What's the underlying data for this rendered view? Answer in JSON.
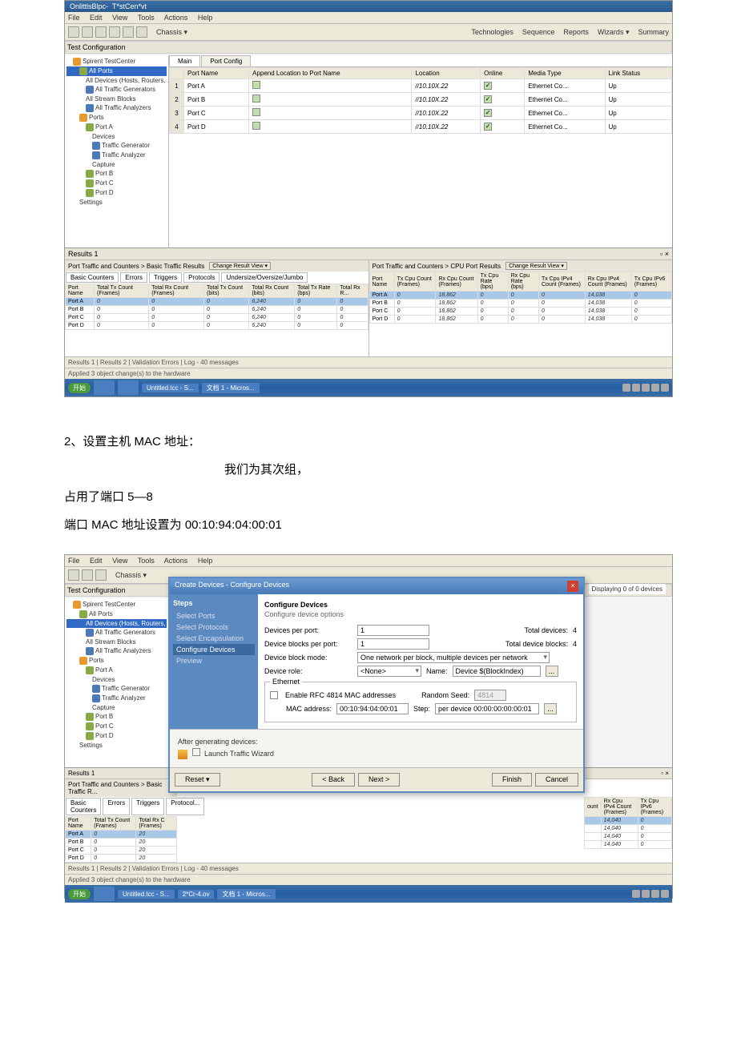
{
  "shot1": {
    "title_left": "OnlittlsBlpc-",
    "title_app": "T*stCen*vt",
    "menu": [
      "File",
      "Edit",
      "View",
      "Tools",
      "Actions",
      "Help"
    ],
    "toolbar_tabs": [
      "Technologies",
      "Sequence",
      "Reports",
      "Wizards",
      "Summary"
    ],
    "tree_header": "Test Configuration",
    "tree": {
      "root": "Spirent TestCenter",
      "all_ports": "All Ports",
      "all_devices": "All Devices (Hosts, Routers, ...)",
      "traffic_gen": "All Traffic Generators",
      "stream_blocks": "All Stream Blocks",
      "traffic_analyzers": "All Traffic Analyzers",
      "ports": "Ports",
      "port_a": "Port A",
      "devices": "Devices",
      "t_gen": "Traffic Generator",
      "t_ana": "Traffic Analyzer",
      "capture": "Capture",
      "port_b": "Port B",
      "port_c": "Port C",
      "port_d": "Port D",
      "settings": "Settings"
    },
    "port_tabs": {
      "main": "Main",
      "port_config": "Port Config"
    },
    "port_grid": {
      "headers": [
        "Port Name",
        "Append Location to Port Name",
        "Location",
        "Online",
        "Media Type",
        "Link Status"
      ],
      "rows": [
        {
          "idx": "1",
          "name": "Port A",
          "loc": "//10.10X.22",
          "media": "Ethernet Co...",
          "link": "Up"
        },
        {
          "idx": "2",
          "name": "Port B",
          "loc": "//10.10X.22",
          "media": "Ethernet Co...",
          "link": "Up"
        },
        {
          "idx": "3",
          "name": "Port C",
          "loc": "//10.10X.22",
          "media": "Ethernet Co...",
          "link": "Up"
        },
        {
          "idx": "4",
          "name": "Port D",
          "loc": "//10.10X.22",
          "media": "Ethernet Co...",
          "link": "Up"
        }
      ]
    },
    "results_label": "Results 1",
    "results_left_title": "Port Traffic and Counters > Basic Traffic Results",
    "results_right_title": "Port Traffic and Counters > CPU Port Results",
    "change_view": "Change Result View",
    "subtabs": [
      "Basic Counters",
      "Errors",
      "Triggers",
      "Protocols",
      "Undersize/Oversize/Jumbo"
    ],
    "left_headers": [
      "Port Name",
      "Total Tx Count (Frames)",
      "Total Rx Count (Frames)",
      "Total Tx Count (bits)",
      "Total Rx Count (bits)",
      "Total Tx Rate (bps)",
      "Total Rx R..."
    ],
    "right_headers": [
      "Port Name",
      "Tx Cpu Count (Frames)",
      "Rx Cpu Count (Frames)",
      "Tx Cpu Rate (bps)",
      "Rx Cpu Rate (bps)",
      "Tx Cpu IPv4 Count (Frames)",
      "Rx Cpu IPv4 Count (Frames)",
      "Tx Cpu IPv6 (Frames)"
    ],
    "left_rows": [
      {
        "name": "Port A",
        "c1": "0",
        "c2": "0",
        "c3": "0",
        "c4": "6,240",
        "c5": "0",
        "c6": "0"
      },
      {
        "name": "Port B",
        "c1": "0",
        "c2": "0",
        "c3": "0",
        "c4": "6,240",
        "c5": "0",
        "c6": "0"
      },
      {
        "name": "Port C",
        "c1": "0",
        "c2": "0",
        "c3": "0",
        "c4": "6,240",
        "c5": "0",
        "c6": "0"
      },
      {
        "name": "Port D",
        "c1": "0",
        "c2": "0",
        "c3": "0",
        "c4": "6,240",
        "c5": "0",
        "c6": "0"
      }
    ],
    "right_rows": [
      {
        "name": "Port A",
        "c1": "0",
        "c2": "18,862",
        "c3": "0",
        "c4": "0",
        "c5": "0",
        "c6": "14,038",
        "c7": "0"
      },
      {
        "name": "Port B",
        "c1": "0",
        "c2": "18,862",
        "c3": "0",
        "c4": "0",
        "c5": "0",
        "c6": "14,038",
        "c7": "0"
      },
      {
        "name": "Port C",
        "c1": "0",
        "c2": "18,862",
        "c3": "0",
        "c4": "0",
        "c5": "0",
        "c6": "14,038",
        "c7": "0"
      },
      {
        "name": "Port D",
        "c1": "0",
        "c2": "18,862",
        "c3": "0",
        "c4": "0",
        "c5": "0",
        "c6": "14,038",
        "c7": "0"
      }
    ],
    "bottom_tabs": "Results 1 | Results 2 | Validation Errors | Log - 40 messages",
    "status": "Applied 3 object change(s) to the hardware",
    "taskbar": {
      "items": [
        "",
        "",
        "",
        "Untitled.tcc - S..."
      ],
      "item5": "文档 1 - Micros..."
    }
  },
  "body": {
    "line1": "2、设置主机 MAC 地址：",
    "line2": "我们为其次组，",
    "line3": "占用了端口 5—8",
    "line4": "端口 MAC 地址设置为 00:10:94:04:00:01"
  },
  "shot2": {
    "dialog_title": "Create Devices - Configure Devices",
    "steps_hdr": "Steps",
    "steps": [
      "Select Ports",
      "Select Protocols",
      "Select Encapsulation",
      "Configure Devices",
      "Preview"
    ],
    "cfg_title": "Configure Devices",
    "cfg_sub": "Configure device options",
    "dev_per_port_lbl": "Devices per port:",
    "dev_per_port_val": "1",
    "total_dev_lbl": "Total devices:",
    "total_dev_val": "4",
    "blk_per_port_lbl": "Device blocks per port:",
    "blk_per_port_val": "1",
    "total_blk_lbl": "Total device blocks:",
    "total_blk_val": "4",
    "blk_mode_lbl": "Device block mode:",
    "blk_mode_val": "One network per block, multiple devices per network",
    "dev_role_lbl": "Device role:",
    "dev_role_val": "<None>",
    "name_lbl": "Name:",
    "name_val": "Device $(BlockIndex)",
    "ethernet_grp": "Ethernet",
    "enable_rfc": "Enable RFC 4814 MAC addresses",
    "random_seed_lbl": "Random Seed:",
    "random_seed_val": "4814",
    "mac_lbl": "MAC address:",
    "mac_val": "00:10:94:04:00:01",
    "step_lbl": "Step:",
    "step_val": "per device 00:00:00:00:00:01",
    "after_gen": "After generating devices:",
    "launch_wiz": "Launch Traffic Wizard",
    "reset_btn": "Reset",
    "back_btn": "< Back",
    "next_btn": "Next >",
    "finish_btn": "Finish",
    "cancel_btn": "Cancel",
    "displaying": "Displaying 0 of 0 devices",
    "tree_all_devices_sel": "All Devices (Hosts, Routers, ...)",
    "small_results_title": "Port Traffic and Counters > Basic Traffic R...",
    "small_subtabs": [
      "Basic Counters",
      "Errors",
      "Triggers",
      "Protocol..."
    ],
    "small_headers": [
      "Port Name",
      "Total Tx Count (Frames)",
      "Total Rx C (Frames)"
    ],
    "small_rows": [
      {
        "name": "Port A",
        "c1": "0",
        "c2": "20"
      },
      {
        "name": "Port B",
        "c1": "0",
        "c2": "20"
      },
      {
        "name": "Port C",
        "c1": "0",
        "c2": "20"
      },
      {
        "name": "Port D",
        "c1": "0",
        "c2": "20"
      }
    ],
    "right_headers": [
      "ount",
      "Rx Cpu IPv4 Count (Frames)",
      "Tx Cpu IPv6 (Frames)"
    ],
    "right_rows": [
      {
        "c1": "14,040",
        "c2": "0"
      },
      {
        "c1": "14,040",
        "c2": "0"
      },
      {
        "c1": "14,040",
        "c2": "0"
      },
      {
        "c1": "14,040",
        "c2": "0"
      }
    ],
    "taskbar_extra": "2*Cr-4.ov"
  }
}
